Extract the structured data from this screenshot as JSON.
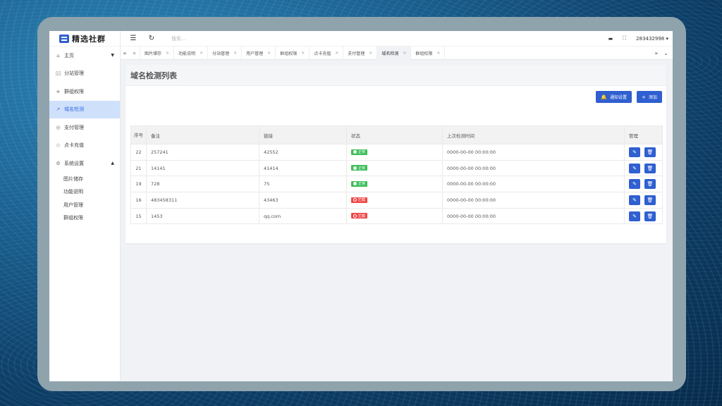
{
  "brand": {
    "name": "精选社群",
    "accent": "#2f5fd0"
  },
  "sidebar": {
    "items": [
      {
        "label": "主页",
        "icon": "home-icon"
      },
      {
        "label": "分站管理",
        "icon": "grid-icon"
      },
      {
        "label": "群组权限",
        "icon": "sliders-icon"
      },
      {
        "label": "域名检测",
        "icon": "send-icon"
      },
      {
        "label": "支付管理",
        "icon": "check-circle-icon"
      },
      {
        "label": "点卡充值",
        "icon": "shield-check-icon"
      },
      {
        "label": "系统设置",
        "icon": "gear-icon"
      }
    ],
    "sub_items": [
      "图片储存",
      "功能说明",
      "用户管理",
      "群组权限"
    ]
  },
  "topbar": {
    "search_placeholder": "搜索...",
    "user": "283432998"
  },
  "tabs": [
    {
      "label": "图片储存"
    },
    {
      "label": "功能说明"
    },
    {
      "label": "分站管理"
    },
    {
      "label": "用户管理"
    },
    {
      "label": "群组权限"
    },
    {
      "label": "点卡充值"
    },
    {
      "label": "支付管理"
    },
    {
      "label": "域名检测"
    },
    {
      "label": "群组权限"
    }
  ],
  "page": {
    "title": "域名检测列表",
    "notify_button": "通知设置",
    "add_button": "添加"
  },
  "table": {
    "headers": [
      "序号",
      "备注",
      "链接",
      "状态",
      "上次检测时间",
      "管理"
    ],
    "rows": [
      {
        "id": "22",
        "note": "257241",
        "link": "42552",
        "status": "正常",
        "time": "0000-00-00 00:00:00"
      },
      {
        "id": "21",
        "note": "14141",
        "link": "41414",
        "status": "正常",
        "time": "0000-00-00 00:00:00"
      },
      {
        "id": "19",
        "note": "728",
        "link": "75",
        "status": "正常",
        "time": "0000-00-00 00:00:00"
      },
      {
        "id": "16",
        "note": "483458311",
        "link": "43463",
        "status": "拦截",
        "time": "0000-00-00 00:00:00"
      },
      {
        "id": "15",
        "note": "1453",
        "link": "qq.com",
        "status": "拦截",
        "time": "0000-00-00 00:00:00"
      }
    ]
  },
  "colors": {
    "ok": "#3cbf5a",
    "blocked": "#f04848",
    "active_nav_bg": "#cfe0fb"
  }
}
